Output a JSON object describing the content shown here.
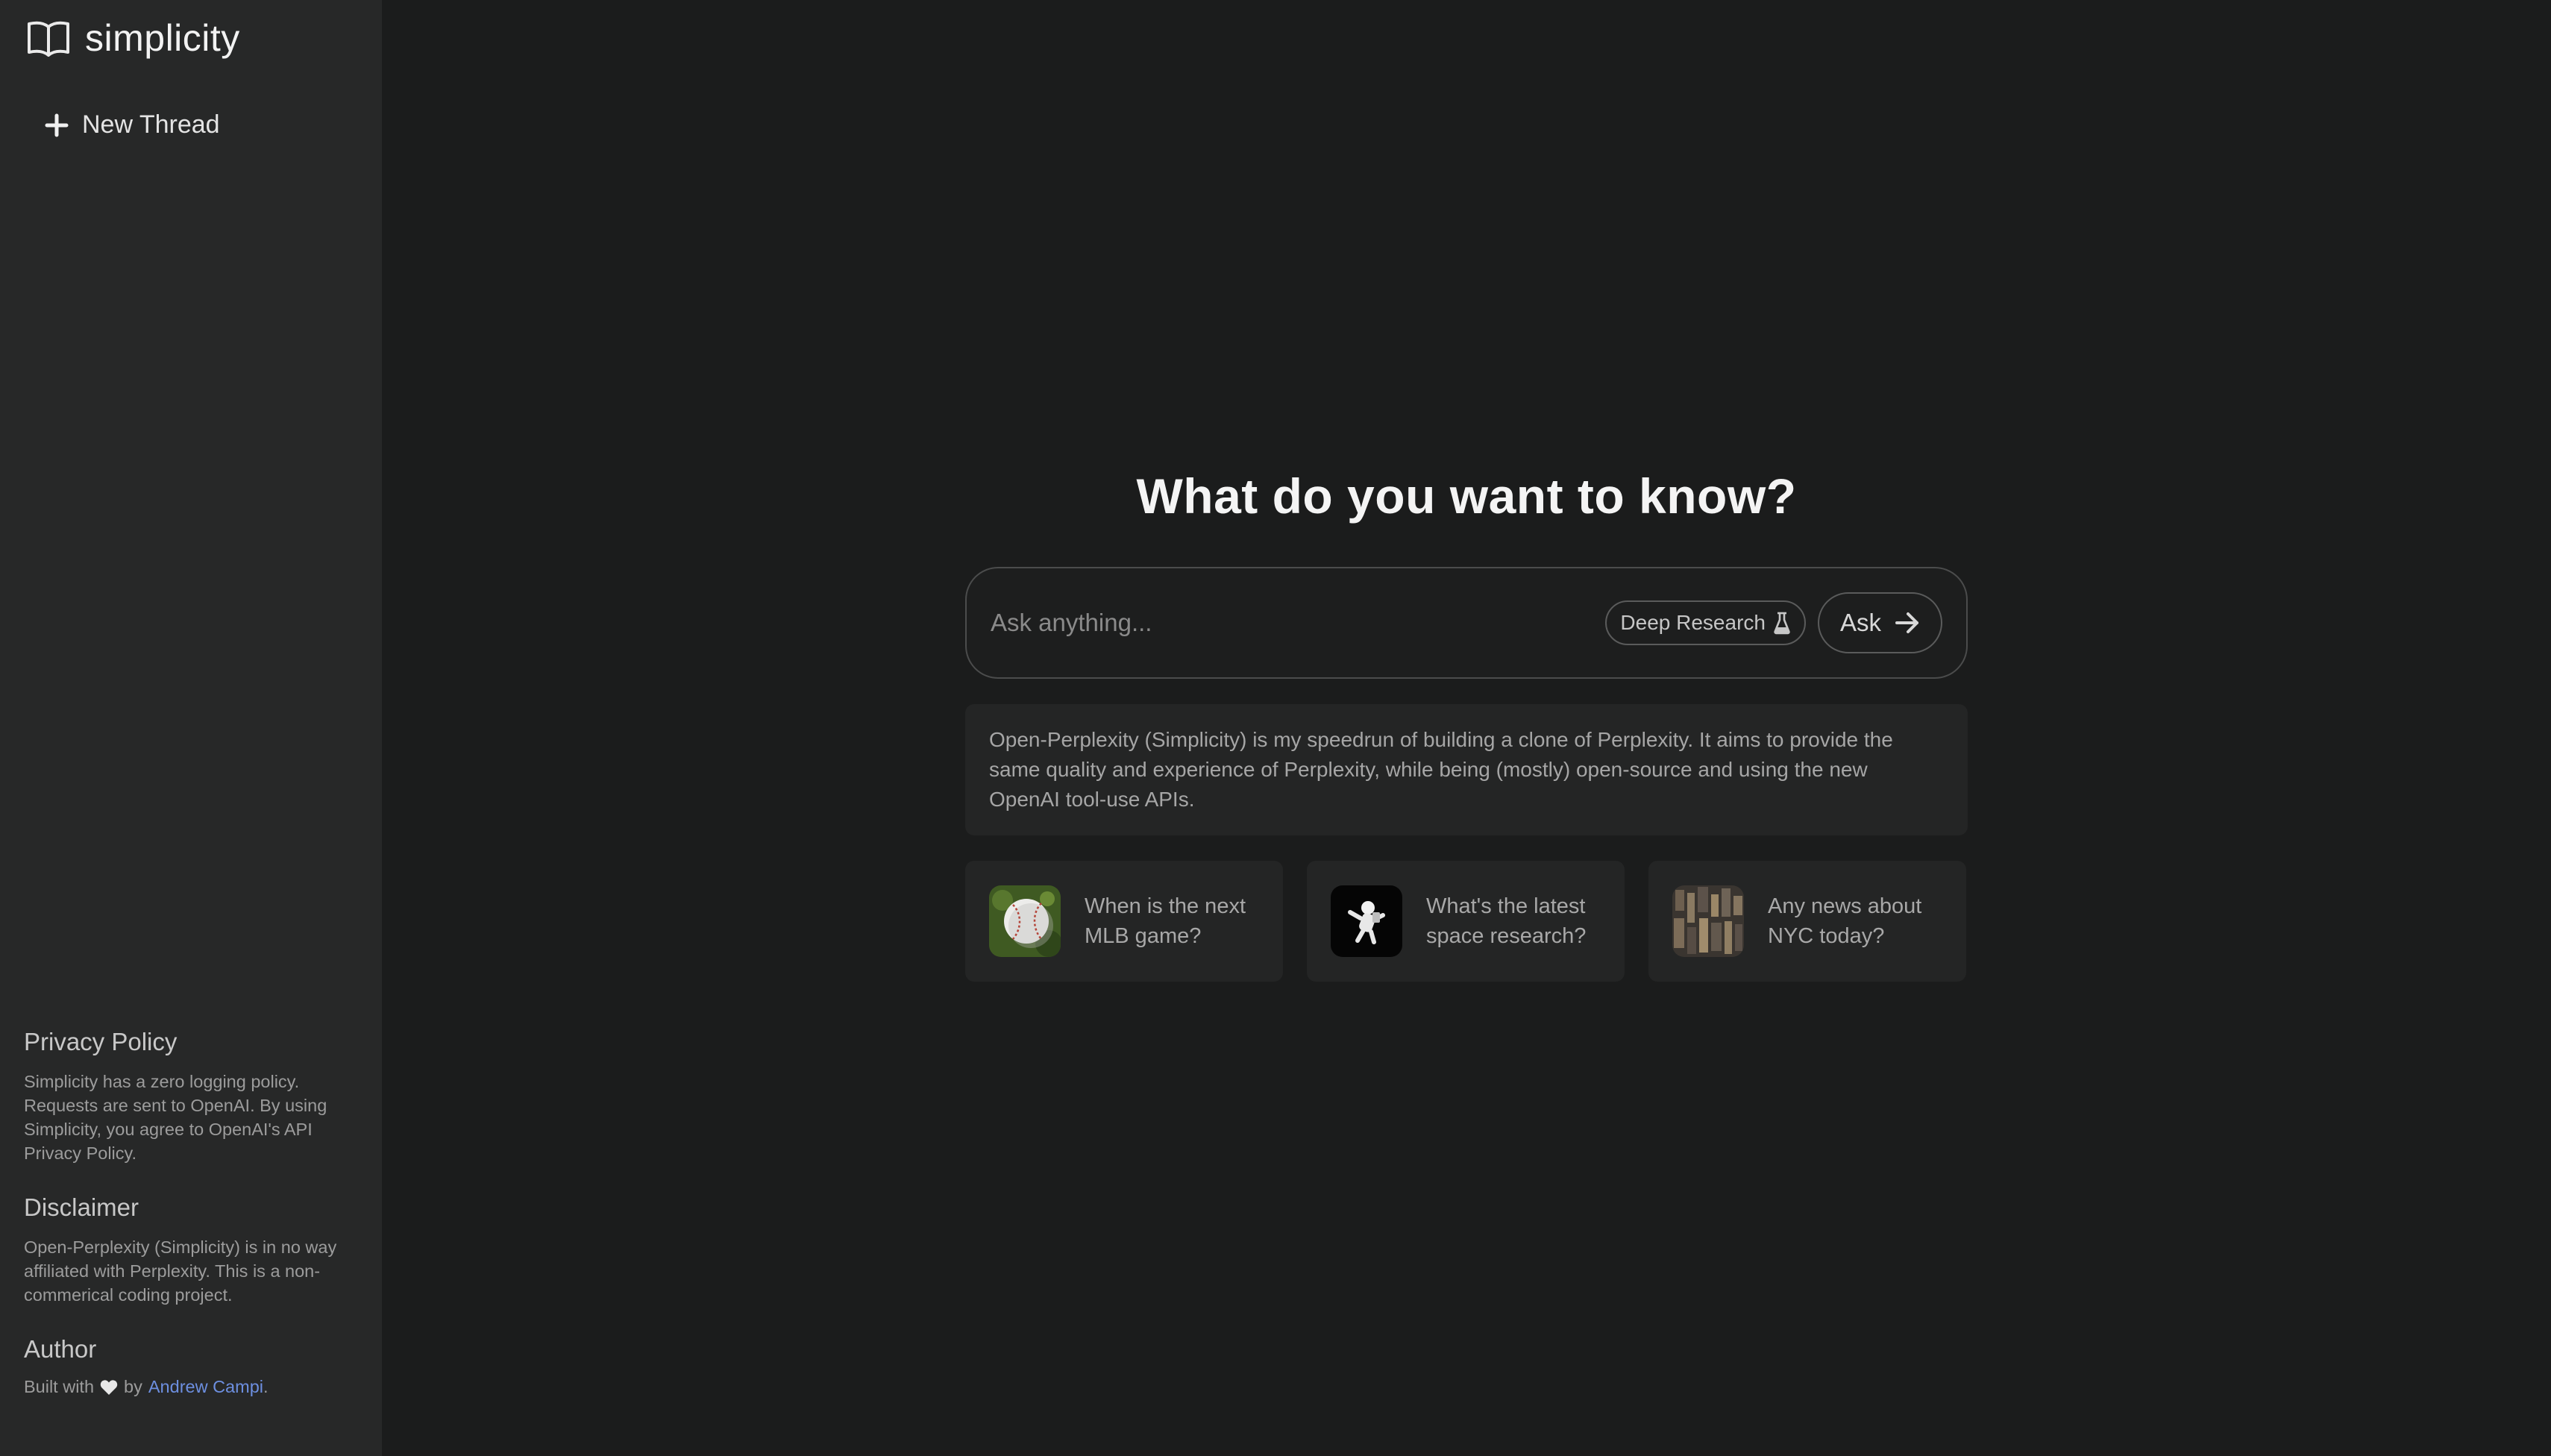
{
  "sidebar": {
    "brand_name": "simplicity",
    "brand_icon": "book-open-icon",
    "new_thread_label": "New Thread",
    "privacy_heading": "Privacy Policy",
    "privacy_text": "Simplicity has a zero logging policy. Requests are sent to OpenAI. By using Simplicity, you agree to OpenAI's API Privacy Policy.",
    "disclaimer_heading": "Disclaimer",
    "disclaimer_text": "Open-Perplexity (Simplicity) is in no way affiliated with Perplexity. This is a non-commerical coding project.",
    "author_heading": "Author",
    "author_prefix": "Built with",
    "author_by": "by",
    "author_name": "Andrew Campi",
    "author_suffix": "."
  },
  "main": {
    "headline": "What do you want to know?",
    "search": {
      "placeholder": "Ask anything...",
      "value": ""
    },
    "deep_research_label": "Deep Research",
    "ask_label": "Ask",
    "about_text": "Open-Perplexity (Simplicity) is my speedrun of building a clone of Perplexity. It aims to provide the same quality and experience of Perplexity, while being (mostly) open-source and using the new OpenAI tool-use APIs.",
    "suggestions": [
      {
        "text": "When is the next MLB game?",
        "icon": "baseball-thumbnail"
      },
      {
        "text": "What's the latest space research?",
        "icon": "astronaut-thumbnail"
      },
      {
        "text": "Any news about NYC today?",
        "icon": "city-thumbnail"
      }
    ]
  },
  "colors": {
    "background": "#1b1c1c",
    "sidebar": "#272828",
    "card": "#242525",
    "link": "#6d8fe0"
  }
}
